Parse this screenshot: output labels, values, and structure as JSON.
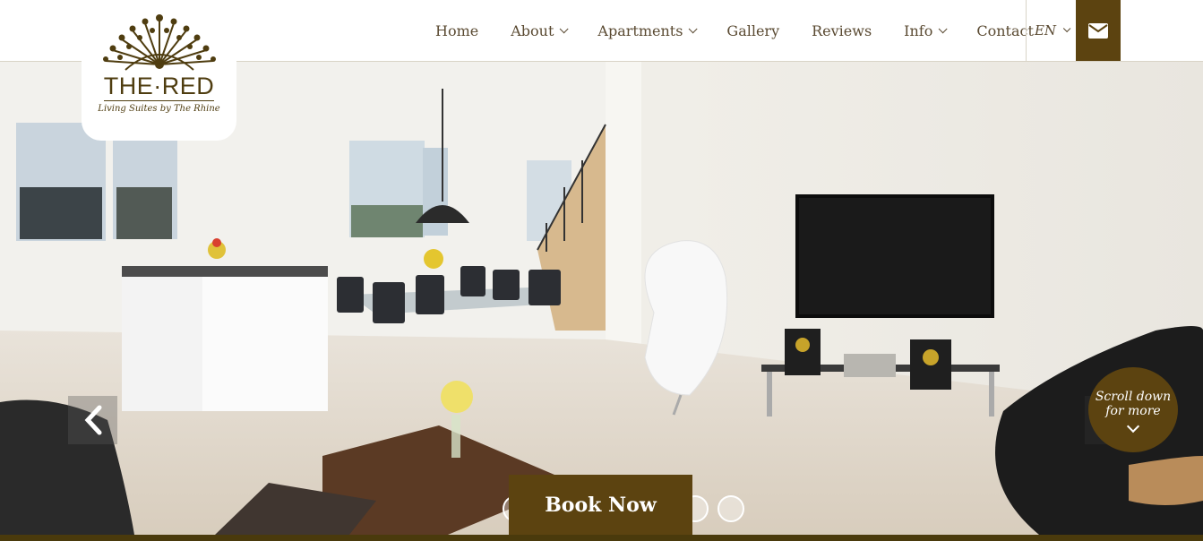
{
  "nav": {
    "items": [
      {
        "label": "Home",
        "has_dropdown": false
      },
      {
        "label": "About",
        "has_dropdown": true
      },
      {
        "label": "Apartments",
        "has_dropdown": true
      },
      {
        "label": "Gallery",
        "has_dropdown": false
      },
      {
        "label": "Reviews",
        "has_dropdown": false
      },
      {
        "label": "Info",
        "has_dropdown": true
      },
      {
        "label": "Contact",
        "has_dropdown": false
      }
    ],
    "language": "EN",
    "mail_icon": "envelope-icon"
  },
  "logo": {
    "title": "THE·RED",
    "subtitle": "Living Suites by The Rhine"
  },
  "hero": {
    "prev_icon": "chevron-left-icon",
    "next_icon": "chevron-right-icon",
    "scroll_line1": "Scroll down",
    "scroll_line2": "for more",
    "book_label": "Book Now"
  },
  "colors": {
    "brand": "#5c4310",
    "nav_text": "#5a4a32"
  }
}
